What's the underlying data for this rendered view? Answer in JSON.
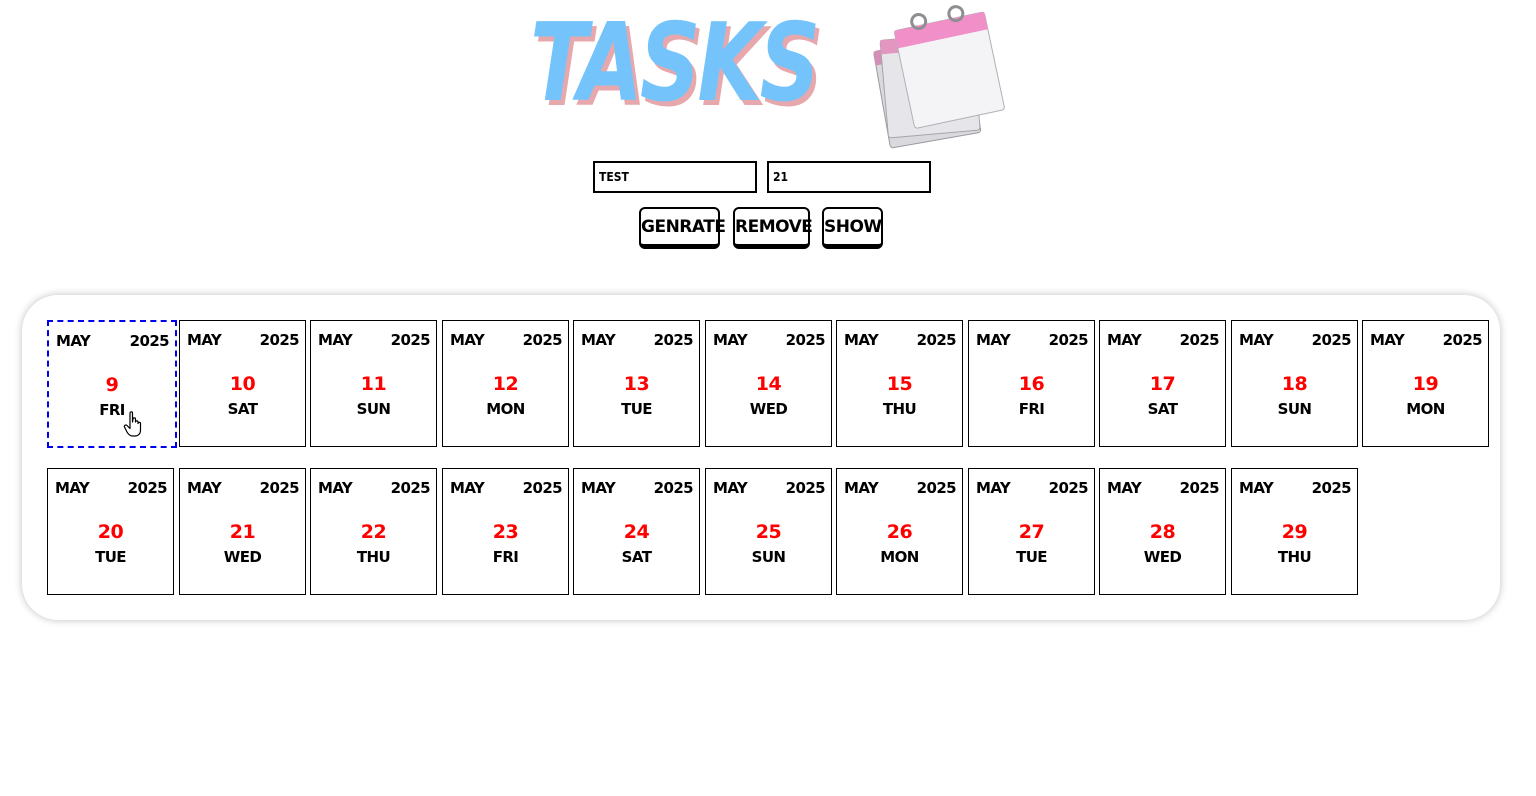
{
  "header": {
    "title": "TASKS",
    "calendar_icon": "calendar-pad-icon"
  },
  "form": {
    "task_value": "TEST",
    "number_value": "21"
  },
  "buttons": {
    "generate": "GENRATE",
    "remove": "REMOVE",
    "show": "SHOW"
  },
  "days": [
    {
      "month": "MAY",
      "year": "2025",
      "day": "9",
      "weekday": "FRI"
    },
    {
      "month": "MAY",
      "year": "2025",
      "day": "10",
      "weekday": "SAT"
    },
    {
      "month": "MAY",
      "year": "2025",
      "day": "11",
      "weekday": "SUN"
    },
    {
      "month": "MAY",
      "year": "2025",
      "day": "12",
      "weekday": "MON"
    },
    {
      "month": "MAY",
      "year": "2025",
      "day": "13",
      "weekday": "TUE"
    },
    {
      "month": "MAY",
      "year": "2025",
      "day": "14",
      "weekday": "WED"
    },
    {
      "month": "MAY",
      "year": "2025",
      "day": "15",
      "weekday": "THU"
    },
    {
      "month": "MAY",
      "year": "2025",
      "day": "16",
      "weekday": "FRI"
    },
    {
      "month": "MAY",
      "year": "2025",
      "day": "17",
      "weekday": "SAT"
    },
    {
      "month": "MAY",
      "year": "2025",
      "day": "18",
      "weekday": "SUN"
    },
    {
      "month": "MAY",
      "year": "2025",
      "day": "19",
      "weekday": "MON"
    },
    {
      "month": "MAY",
      "year": "2025",
      "day": "20",
      "weekday": "TUE"
    },
    {
      "month": "MAY",
      "year": "2025",
      "day": "21",
      "weekday": "WED"
    },
    {
      "month": "MAY",
      "year": "2025",
      "day": "22",
      "weekday": "THU"
    },
    {
      "month": "MAY",
      "year": "2025",
      "day": "23",
      "weekday": "FRI"
    },
    {
      "month": "MAY",
      "year": "2025",
      "day": "24",
      "weekday": "SAT"
    },
    {
      "month": "MAY",
      "year": "2025",
      "day": "25",
      "weekday": "SUN"
    },
    {
      "month": "MAY",
      "year": "2025",
      "day": "26",
      "weekday": "MON"
    },
    {
      "month": "MAY",
      "year": "2025",
      "day": "27",
      "weekday": "TUE"
    },
    {
      "month": "MAY",
      "year": "2025",
      "day": "28",
      "weekday": "WED"
    },
    {
      "month": "MAY",
      "year": "2025",
      "day": "29",
      "weekday": "THU"
    }
  ],
  "colors": {
    "title": "#74c4fb",
    "title_shadow": "#e6a8ad",
    "day_number": "#ff0000",
    "selected_border": "#0000ee",
    "calendar_tab": "#f08fc8"
  }
}
